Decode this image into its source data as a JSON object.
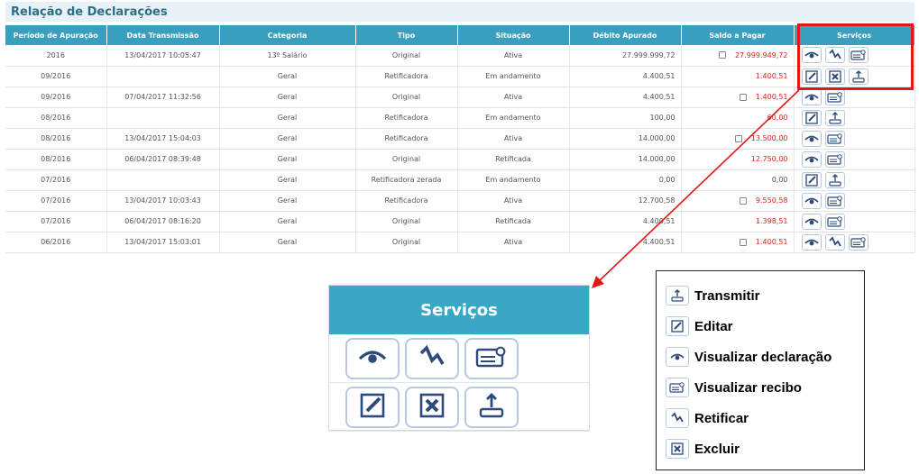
{
  "page": {
    "title": "Relação de Declarações"
  },
  "table": {
    "headers": [
      "Período de Apuração",
      "Data Transmissão",
      "Categoria",
      "Tipo",
      "Situação",
      "Débito Apurado",
      "Saldo a Pagar",
      "Serviços"
    ],
    "rows": [
      {
        "periodo": "2016",
        "data": "13/04/2017 10:05:47",
        "categoria": "13º Salário",
        "tipo": "Original",
        "situacao": "Ativa",
        "debito": "27.999.999,72",
        "saldo": "27.999.949,72",
        "checkbox": true,
        "saldo_red": true,
        "services": [
          "eye-icon",
          "retificar-icon",
          "recibo-icon"
        ]
      },
      {
        "periodo": "09/2016",
        "data": "",
        "categoria": "Geral",
        "tipo": "Retificadora",
        "situacao": "Em andamento",
        "debito": "4.400,51",
        "saldo": "1.400,51",
        "checkbox": false,
        "saldo_red": true,
        "services": [
          "edit-icon",
          "delete-icon",
          "transmit-icon"
        ]
      },
      {
        "periodo": "09/2016",
        "data": "07/04/2017 11:32:56",
        "categoria": "Geral",
        "tipo": "Original",
        "situacao": "Ativa",
        "debito": "4.400,51",
        "saldo": "1.400,51",
        "checkbox": true,
        "saldo_red": true,
        "services": [
          "eye-icon",
          "recibo-icon"
        ]
      },
      {
        "periodo": "08/2016",
        "data": "",
        "categoria": "Geral",
        "tipo": "Retificadora",
        "situacao": "Em andamento",
        "debito": "100,00",
        "saldo": "60,00",
        "checkbox": false,
        "saldo_red": true,
        "services": [
          "edit-icon",
          "transmit-icon"
        ]
      },
      {
        "periodo": "08/2016",
        "data": "13/04/2017 15:04:03",
        "categoria": "Geral",
        "tipo": "Retificadora",
        "situacao": "Ativa",
        "debito": "14.000,00",
        "saldo": "13.500,00",
        "checkbox": true,
        "saldo_red": true,
        "services": [
          "eye-icon",
          "recibo-icon"
        ]
      },
      {
        "periodo": "08/2016",
        "data": "06/04/2017 08:39:48",
        "categoria": "Geral",
        "tipo": "Original",
        "situacao": "Retificada",
        "debito": "14.000,00",
        "saldo": "12.750,00",
        "checkbox": false,
        "saldo_red": true,
        "services": [
          "eye-icon",
          "recibo-icon"
        ]
      },
      {
        "periodo": "07/2016",
        "data": "",
        "categoria": "Geral",
        "tipo": "Retificadora zerada",
        "situacao": "Em andamento",
        "debito": "0,00",
        "saldo": "0,00",
        "checkbox": false,
        "saldo_red": false,
        "services": [
          "edit-icon",
          "transmit-icon"
        ]
      },
      {
        "periodo": "07/2016",
        "data": "13/04/2017 10:03:43",
        "categoria": "Geral",
        "tipo": "Retificadora",
        "situacao": "Ativa",
        "debito": "12.700,58",
        "saldo": "9.550,58",
        "checkbox": true,
        "saldo_red": true,
        "services": [
          "eye-icon",
          "recibo-icon"
        ]
      },
      {
        "periodo": "07/2016",
        "data": "06/04/2017 08:16:20",
        "categoria": "Geral",
        "tipo": "Original",
        "situacao": "Retificada",
        "debito": "4.400,51",
        "saldo": "1.398,51",
        "checkbox": false,
        "saldo_red": true,
        "services": [
          "eye-icon",
          "recibo-icon"
        ]
      },
      {
        "periodo": "06/2016",
        "data": "13/04/2017 15:03:01",
        "categoria": "Geral",
        "tipo": "Original",
        "situacao": "Ativa",
        "debito": "4.400,51",
        "saldo": "1.400,51",
        "checkbox": true,
        "saldo_red": true,
        "services": [
          "eye-icon",
          "retificar-icon",
          "recibo-icon"
        ]
      }
    ]
  },
  "zoom": {
    "title": "Serviços"
  },
  "legend": {
    "items": [
      {
        "icon": "transmit-icon",
        "label": "Transmitir"
      },
      {
        "icon": "edit-icon",
        "label": "Editar"
      },
      {
        "icon": "eye-icon",
        "label": "Visualizar declaração"
      },
      {
        "icon": "recibo-icon",
        "label": "Visualizar recibo"
      },
      {
        "icon": "retificar-icon",
        "label": "Retificar"
      },
      {
        "icon": "delete-icon",
        "label": "Excluir"
      }
    ]
  },
  "colors": {
    "header": "#3a9fbf",
    "highlight": "#e01818",
    "saldo": "#e02020",
    "title": "#2a6f87"
  }
}
